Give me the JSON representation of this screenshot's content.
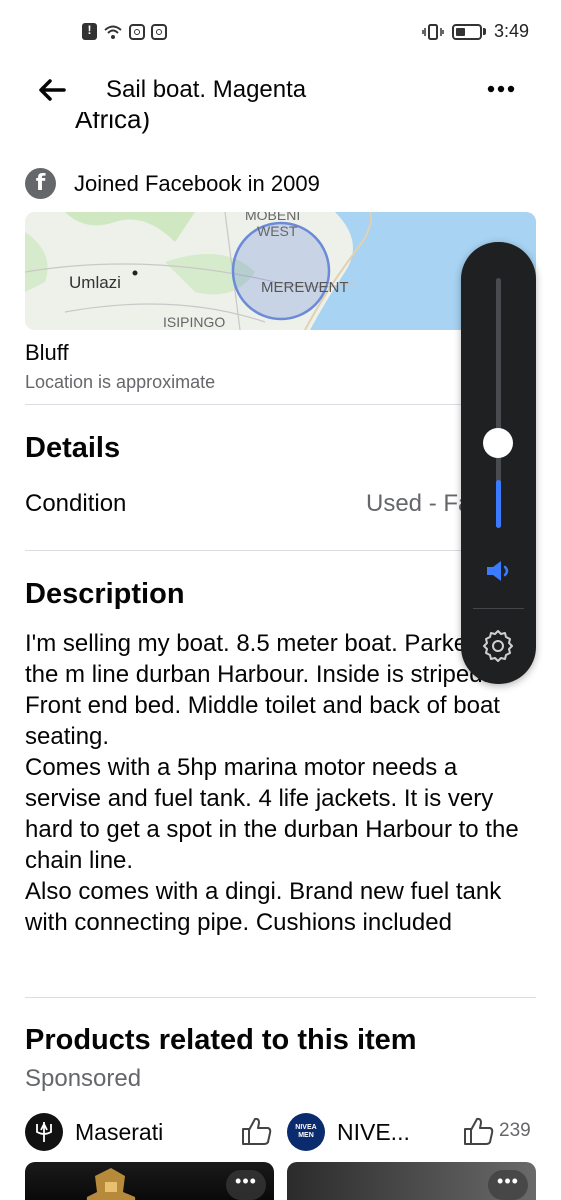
{
  "status_bar": {
    "time": "3:49",
    "left_icons": [
      "alert-icon",
      "wifi-icon",
      "instagram-icon",
      "instagram-icon"
    ],
    "right_icons": [
      "vibrate-icon",
      "battery-icon"
    ]
  },
  "header": {
    "title": "Sail boat. Magenta",
    "back_icon": "back-arrow-icon",
    "more_icon": "more-horizontal-icon"
  },
  "seller": {
    "location_partial": "Africa)",
    "joined": "Joined Facebook in 2009"
  },
  "map": {
    "labels": [
      "MOBENI WEST",
      "MEREWENT",
      "Umlazi",
      "ISIPINGO"
    ]
  },
  "location": {
    "name": "Bluff",
    "note": "Location is approximate"
  },
  "details": {
    "title": "Details",
    "condition_label": "Condition",
    "condition_value": "Used - Fair"
  },
  "description": {
    "title": "Description",
    "text": "I'm selling my boat. 8.5 meter boat. Parked on the m line durban Harbour. Inside is striped. Front end bed. Middle toilet and back of boat seating.\nComes with a 5hp marina motor needs a servise  and fuel tank. 4 life jackets. It is very hard to get a spot in the durban Harbour to the chain line.\nAlso comes with a dingi. Brand new fuel tank with connecting pipe. Cushions included"
  },
  "products": {
    "title": "Products related to this item",
    "sponsored": "Sponsored",
    "items": [
      {
        "brand": "Maserati",
        "likes": "",
        "logo_text": ""
      },
      {
        "brand": "NIVE...",
        "likes": "239",
        "logo_text": "NIVEA MEN"
      }
    ]
  },
  "volume_panel": {
    "level": 0.19,
    "speaker_icon": "speaker-icon",
    "settings_icon": "gear-icon",
    "accent": "#3a7bff"
  }
}
